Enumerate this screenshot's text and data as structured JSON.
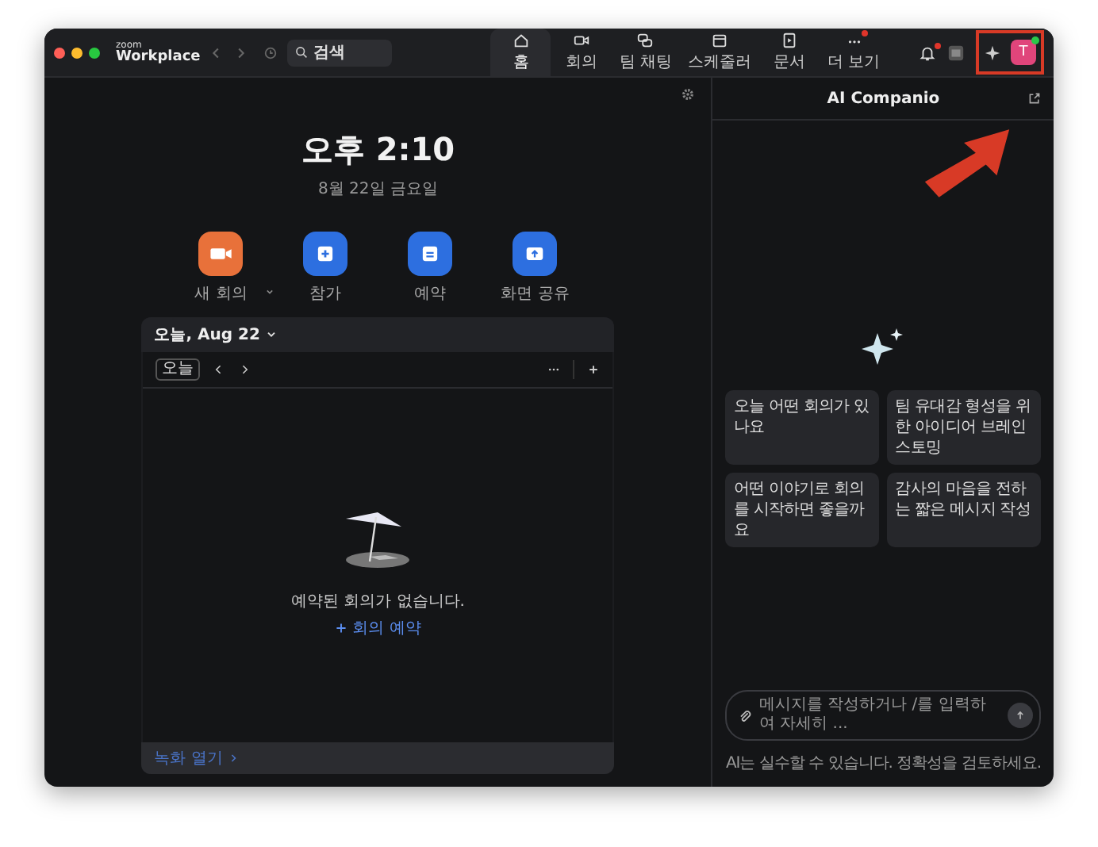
{
  "app": {
    "brand_small": "zoom",
    "brand": "Workplace"
  },
  "search": {
    "placeholder": "검색"
  },
  "tabs": [
    {
      "label": "홈",
      "kind": "home",
      "selected": true,
      "notification": false
    },
    {
      "label": "회의",
      "kind": "video",
      "selected": false,
      "notification": false
    },
    {
      "label": "팀 채팅",
      "kind": "chat",
      "selected": false,
      "notification": false
    },
    {
      "label": "스케줄러",
      "kind": "scheduler",
      "selected": false,
      "notification": false
    },
    {
      "label": "문서",
      "kind": "doc",
      "selected": false,
      "notification": false
    },
    {
      "label": "더 보기",
      "kind": "more",
      "selected": false,
      "notification": true
    }
  ],
  "toolbar": {
    "bell_notification": true,
    "avatar_initial": "T",
    "online": true
  },
  "home": {
    "time": "오후 2:10",
    "date": "8월 22일 금요일",
    "actions": [
      {
        "label": "새 회의",
        "kind": "video",
        "color": "#e8713a",
        "has_menu": true
      },
      {
        "label": "참가",
        "kind": "plus",
        "color": "#2d6fe0",
        "has_menu": false
      },
      {
        "label": "예약",
        "kind": "calendar",
        "color": "#2d6fe0",
        "has_menu": false
      },
      {
        "label": "화면 공유",
        "kind": "share",
        "color": "#2d6fe0",
        "has_menu": false
      }
    ]
  },
  "calendar": {
    "title": "오늘, Aug 22",
    "today_button": "오늘",
    "empty_message": "예약된 회의가 없습니다.",
    "schedule_link": "회의 예약",
    "footer_link": "녹화 열기"
  },
  "ai_panel": {
    "title": "AI Companio",
    "suggestions": [
      "오늘 어떤 회의가 있나요",
      "팀 유대감 형성을 위한 아이디어 브레인스토밍",
      "어떤 이야기로 회의를 시작하면 좋을까요",
      "감사의 마음을 전하는 짧은 메시지 작성"
    ],
    "input_placeholder": "메시지를 작성하거나 /를 입력하여 자세히 ...",
    "disclaimer": "AI는 실수할 수 있습니다. 정확성을 검토하세요."
  }
}
